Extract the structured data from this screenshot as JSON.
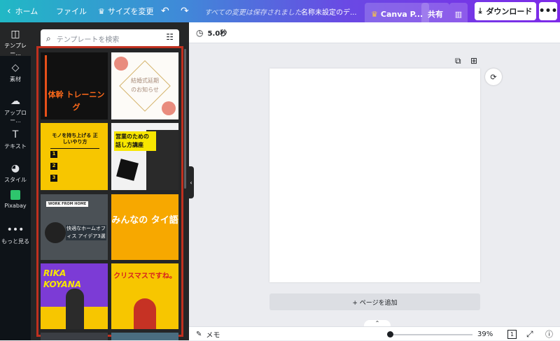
{
  "topbar": {
    "home": "ホーム",
    "file": "ファイル",
    "resize": "サイズを変更",
    "saved_status": "すべての変更は保存されました",
    "doc_title": "名称未設定のデ...",
    "canva_pro": "Canva P...",
    "share": "共有",
    "download": "ダウンロード"
  },
  "rail": {
    "templates": "テンプレー...",
    "elements": "素材",
    "uploads": "アップロー...",
    "text": "テキスト",
    "styles": "スタイル",
    "pixabay": "Pixabay",
    "more": "もっと見る"
  },
  "search": {
    "placeholder": "テンプレートを検索"
  },
  "templates": [
    {
      "title": "体幹 トレーニング"
    },
    {
      "title": "結婚式延期のお知らせ"
    },
    {
      "title": "モノを持ち上げる 正しいやり方",
      "items": [
        "1",
        "2",
        "3"
      ]
    },
    {
      "title": "営業のための 話し方講座"
    },
    {
      "title": "快適なホームオフィス アイデア3選",
      "header": "WORK FROM HOME"
    },
    {
      "title": "みんなの タイ語"
    },
    {
      "title": "RIKA KOYANA"
    },
    {
      "title": "クリスマスですね。"
    }
  ],
  "toolbar": {
    "duration": "5.0秒"
  },
  "canvas": {
    "add_page": "+ ページを追加"
  },
  "footer": {
    "notes": "メモ",
    "zoom": "39%",
    "page_count": "1"
  }
}
